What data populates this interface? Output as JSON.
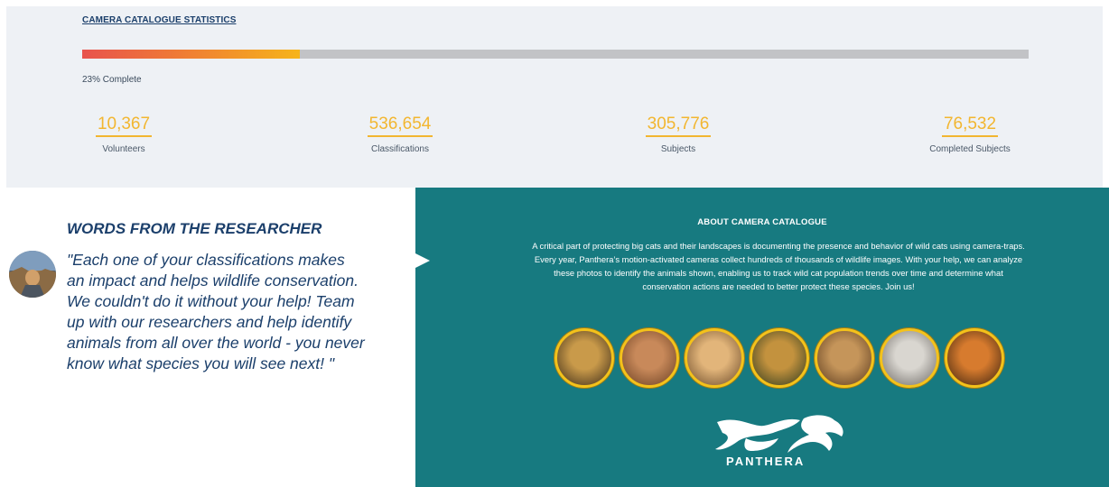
{
  "stats": {
    "title": "CAMERA CATALOGUE STATISTICS",
    "progress_percent": 23,
    "progress_label": "23% Complete",
    "items": [
      {
        "value": "10,367",
        "label": "Volunteers"
      },
      {
        "value": "536,654",
        "label": "Classifications"
      },
      {
        "value": "305,776",
        "label": "Subjects"
      },
      {
        "value": "76,532",
        "label": "Completed Subjects"
      }
    ]
  },
  "researcher": {
    "heading": "WORDS FROM THE RESEARCHER",
    "quote": "\"Each one of your classifications makes an impact and helps wildlife conservation. We couldn't do it without your help! Team up with our researchers and help identify animals from all over the world - you never know what species you will see next! \""
  },
  "about": {
    "title": "ABOUT CAMERA CATALOGUE",
    "body": "A critical part of protecting big cats and their landscapes is documenting the presence and behavior of wild cats using camera-traps. Every year, Panthera’s motion-activated cameras collect hundreds of thousands of wildlife images. With your help, we can analyze these photos to identify the animals shown, enabling us to track wild cat population trends over time and determine what conservation actions are needed to better protect these species. Join us!",
    "cats": [
      {
        "name": "leopard",
        "color_a": "#c99a4a",
        "color_b": "#3a2a18"
      },
      {
        "name": "lion",
        "color_a": "#c8895a",
        "color_b": "#6a3f22"
      },
      {
        "name": "cheetah",
        "color_a": "#e2b57a",
        "color_b": "#6b4a2a"
      },
      {
        "name": "jaguar",
        "color_a": "#c3923e",
        "color_b": "#2d3a1e"
      },
      {
        "name": "puma",
        "color_a": "#c5955a",
        "color_b": "#5a3a1e"
      },
      {
        "name": "snow-leopard",
        "color_a": "#d9d6d0",
        "color_b": "#6b6763"
      },
      {
        "name": "tiger",
        "color_a": "#d77b2e",
        "color_b": "#3a220f"
      }
    ],
    "logo_text": "PANTHERA"
  }
}
